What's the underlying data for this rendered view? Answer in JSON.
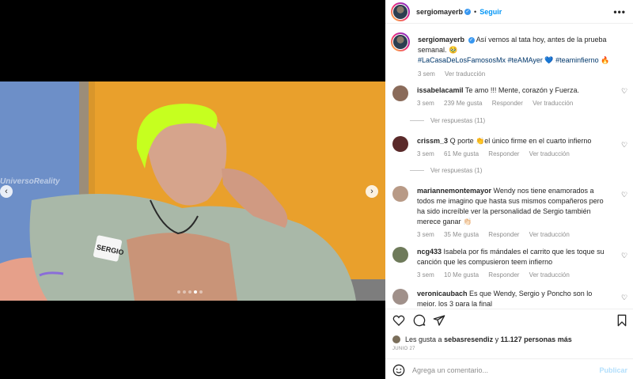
{
  "header": {
    "username": "sergiomayerb",
    "follow_label": "Seguir",
    "more_label": "•••"
  },
  "media": {
    "watermark": "UniversoReality",
    "jacket_label": "SERGIO",
    "prev_label": "‹",
    "next_label": "›",
    "dots": 5,
    "active_dot": 3
  },
  "caption": {
    "username": "sergiomayerb",
    "text": "Así vemos al tata hoy, antes de la prueba semanal. 🥹",
    "hashtags": "#LaCasaDeLosFamososMx #teAMAyer 💙 #teaminfierno 🔥",
    "time": "3 sem",
    "translate": "Ver traducción"
  },
  "comments": [
    {
      "username": "issabelacamil",
      "text": "Te amo !!! Mente, corazón y Fuerza.",
      "time": "3 sem",
      "likes": "239 Me gusta",
      "reply": "Responder",
      "translate": "Ver traducción",
      "replies": "Ver respuestas (11)"
    },
    {
      "username": "crissm_3",
      "text": "Q porte 👏el único firme en el cuarto infierno",
      "time": "3 sem",
      "likes": "61 Me gusta",
      "reply": "Responder",
      "translate": "Ver traducción",
      "replies": "Ver respuestas (1)"
    },
    {
      "username": "mariannemontemayor",
      "text": "Wendy nos tiene enamorados a todos me imagino que hasta sus mismos compañeros pero ha sido increíble ver la personalidad de Sergio también merece ganar 👏🏻",
      "time": "3 sem",
      "likes": "35 Me gusta",
      "reply": "Responder",
      "translate": "Ver traducción"
    },
    {
      "username": "ncg433",
      "text": "Isabela por fis mándales el carrito que les toque su canción que les compusieron teem infierno",
      "time": "3 sem",
      "likes": "10 Me gusta",
      "reply": "Responder",
      "translate": "Ver traducción"
    },
    {
      "username": "veronicaubach",
      "text": "Es que Wendy, Sergio y Poncho son lo mejor, los 3 para la final"
    }
  ],
  "likes": {
    "prefix": "Les gusta a",
    "user": "sebasresendiz",
    "middle": "y",
    "count": "11.127 personas más"
  },
  "date": "JUNIO 27",
  "add_comment": {
    "placeholder": "Agrega un comentario...",
    "publish_label": "Publicar"
  },
  "colors": {
    "accent": "#0095f6",
    "link": "#00376b",
    "muted": "#8e8e8e",
    "publish_disabled": "#b2dffc"
  }
}
